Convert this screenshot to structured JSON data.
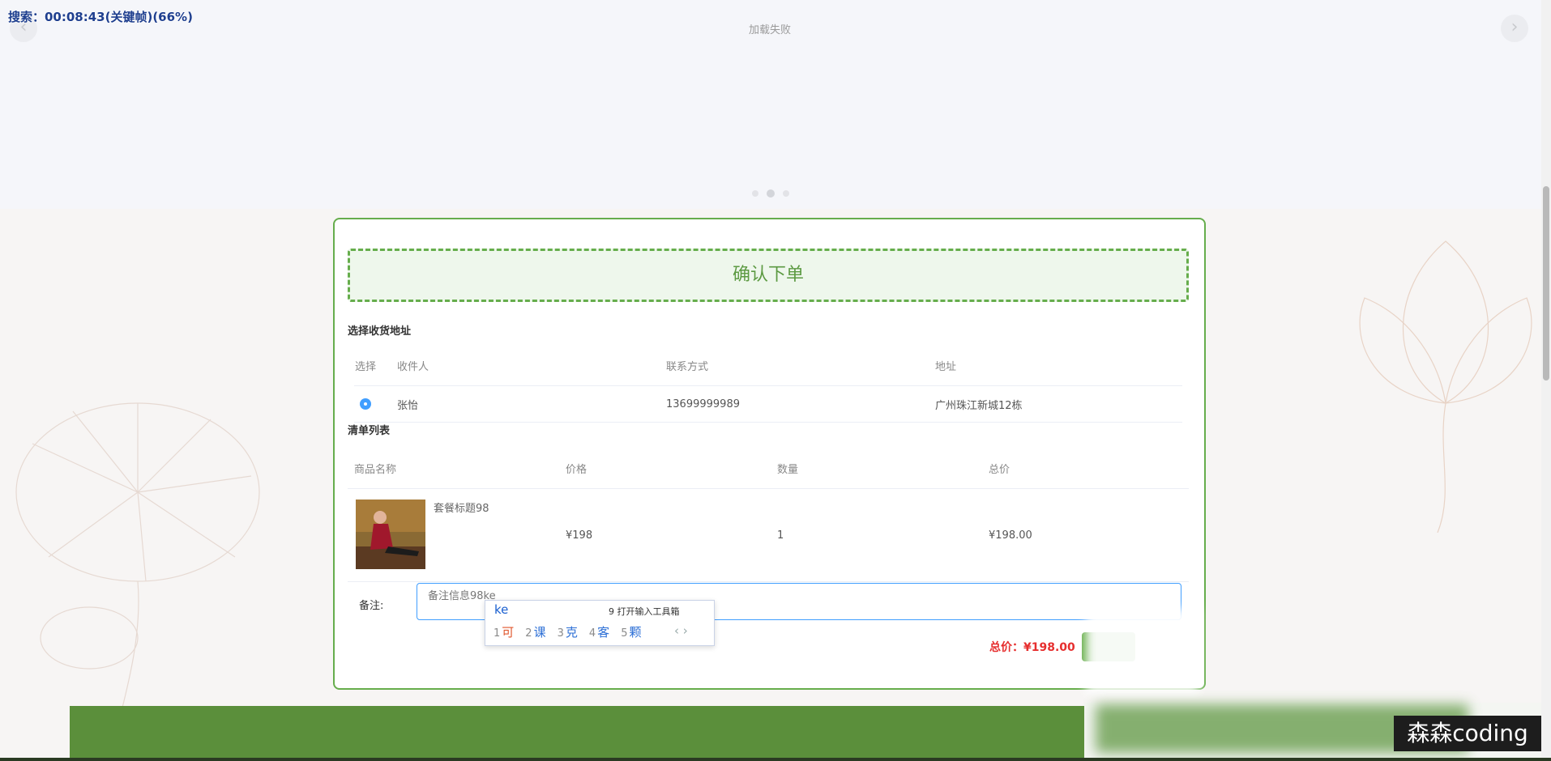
{
  "recording_overlay": "搜索：00:08:43(关键帧)(66%)",
  "carousel": {
    "load_failed": "加载失败",
    "prev_icon": "‹",
    "next_icon": "›"
  },
  "order": {
    "heading": "确认下单",
    "address_section": "选择收货地址",
    "address_columns": [
      "选择",
      "收件人",
      "联系方式",
      "地址"
    ],
    "address_rows": [
      {
        "recipient": "张怡",
        "phone": "13699999989",
        "address": "广州珠江新城12栋"
      }
    ],
    "items_section": "清单列表",
    "item_columns": [
      "商品名称",
      "价格",
      "数量",
      "总价"
    ],
    "items": [
      {
        "title": "套餐标题98",
        "price": "¥198",
        "quantity": "1",
        "total": "¥198.00"
      }
    ],
    "remark_label": "备注:",
    "remark_value": "备注信息98ke",
    "total_label": "总价：¥198.00"
  },
  "ime": {
    "composition": "ke",
    "toolbox": "9 打开输入工具箱",
    "candidates": [
      {
        "n": "1",
        "c": "可"
      },
      {
        "n": "2",
        "c": "课"
      },
      {
        "n": "3",
        "c": "克"
      },
      {
        "n": "4",
        "c": "客"
      },
      {
        "n": "5",
        "c": "颗"
      }
    ],
    "nav": "‹ ›"
  },
  "watermark": "森森coding",
  "colors": {
    "accent_green": "#66ad4c",
    "price_red": "#e62e2e",
    "radio_blue": "#409eff"
  }
}
